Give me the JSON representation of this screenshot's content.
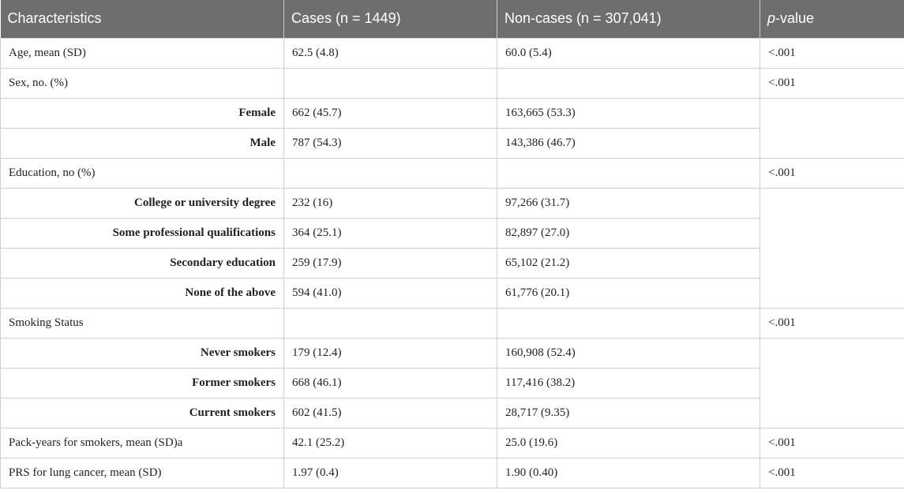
{
  "header": {
    "col1": "Characteristics",
    "col2": "Cases (n = 1449)",
    "col3": "Non-cases (n = 307,041)",
    "col4_italic": "p",
    "col4_rest": "-value"
  },
  "rows": [
    {
      "label": "Age, mean (SD)",
      "cases": "62.5 (4.8)",
      "noncases": "60.0 (5.4)",
      "p": "<.001"
    },
    {
      "label": "Sex, no. (%)",
      "cases": "",
      "noncases": "",
      "p": "<.001"
    },
    {
      "label": "Female",
      "cases": "662 (45.7)",
      "noncases": "163,665 (53.3)"
    },
    {
      "label": "Male",
      "cases": "787 (54.3)",
      "noncases": "143,386 (46.7)"
    },
    {
      "label": "Education, no (%)",
      "cases": "",
      "noncases": "",
      "p": "<.001"
    },
    {
      "label": "College or university degree",
      "cases": "232 (16)",
      "noncases": "97,266 (31.7)"
    },
    {
      "label": "Some professional qualifications",
      "cases": "364 (25.1)",
      "noncases": "82,897 (27.0)"
    },
    {
      "label": "Secondary education",
      "cases": "259 (17.9)",
      "noncases": "65,102 (21.2)"
    },
    {
      "label": "None of the above",
      "cases": "594 (41.0)",
      "noncases": "61,776 (20.1)"
    },
    {
      "label": "Smoking Status",
      "cases": "",
      "noncases": "",
      "p": "<.001"
    },
    {
      "label": "Never smokers",
      "cases": "179 (12.4)",
      "noncases": "160,908 (52.4)"
    },
    {
      "label": "Former smokers",
      "cases": "668 (46.1)",
      "noncases": "117,416 (38.2)"
    },
    {
      "label": "Current smokers",
      "cases": "602 (41.5)",
      "noncases": "28,717 (9.35)"
    },
    {
      "label": "Pack-years for smokers, mean (SD)a",
      "cases": "42.1 (25.2)",
      "noncases": "25.0 (19.6)",
      "p": "<.001"
    },
    {
      "label": "PRS for lung cancer, mean (SD)",
      "cases": "1.97 (0.4)",
      "noncases": "1.90 (0.40)",
      "p": "<.001"
    }
  ]
}
